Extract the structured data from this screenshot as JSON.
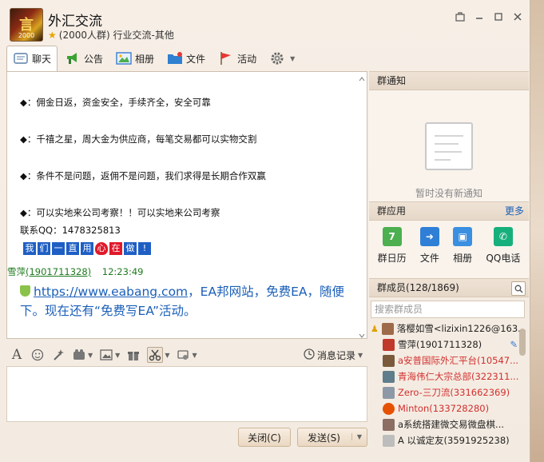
{
  "window": {
    "title": "外汇交流",
    "subtitle": "(2000人群) 行业交流-其他",
    "avatar_text": "言",
    "avatar_sub": "2000"
  },
  "tabs": [
    {
      "label": "聊天",
      "icon": "chat-icon"
    },
    {
      "label": "公告",
      "icon": "announcement-icon"
    },
    {
      "label": "相册",
      "icon": "album-icon"
    },
    {
      "label": "文件",
      "icon": "folder-icon"
    },
    {
      "label": "活动",
      "icon": "flag-icon"
    }
  ],
  "chat": {
    "lines": [
      "◆：佣金日返，资金安全，手续齐全，安全可靠",
      "◆：千禧之星，周大金为供应商，每笔交易都可以实物交割",
      "◆：条件不是问题，返佣不是问题，我们求得是长期合作双赢",
      "◆：可以实地来公司考察！！可以实地来公司考察"
    ],
    "qq_line": "联系QQ：1478325813",
    "banner": [
      "我",
      "们",
      "一",
      "直",
      "用",
      "心",
      "在",
      "做",
      "!"
    ],
    "sender_name": "雪萍",
    "sender_id": "(1901711328)",
    "sender_time": "12:23:49",
    "link_text": "https://www.eabang.com",
    "link_rest": "，EA邦网站，免费EA，随便下。现在还有“免费写EA”活动。"
  },
  "input_toolbar": {
    "history_label": "消息记录"
  },
  "buttons": {
    "close": "关闭(C)",
    "send": "发送(S)"
  },
  "notice": {
    "header": "群通知",
    "empty_text": "暂时没有新通知"
  },
  "apps": {
    "header": "群应用",
    "more": "更多",
    "items": [
      {
        "label": "群日历",
        "icon": "calendar-icon",
        "color": "#4caf50",
        "glyph": "7"
      },
      {
        "label": "文件",
        "icon": "file-transfer-icon",
        "color": "#2f7fd6",
        "glyph": "➜"
      },
      {
        "label": "相册",
        "icon": "album-icon",
        "color": "#3a8fe0",
        "glyph": "▣"
      },
      {
        "label": "QQ电话",
        "icon": "phone-icon",
        "color": "#17b07c",
        "glyph": "✆"
      }
    ]
  },
  "members": {
    "header": "群成员(128/1869)",
    "search_placeholder": "搜索群成员",
    "list": [
      {
        "name": "落樱如雪<lizixin1226@163...",
        "color": "#222",
        "avatar": "#9e6b4a"
      },
      {
        "name": "雪萍(1901711328)",
        "color": "#222",
        "avatar": "#c0392b"
      },
      {
        "name": "a安普国际外汇平台(10547...",
        "color": "#d32f2f",
        "avatar": "#7a5a3a"
      },
      {
        "name": "青海伟仁大宗总部(322311...",
        "color": "#d32f2f",
        "avatar": "#607d8b"
      },
      {
        "name": "Zero-三刀流(331662369)",
        "color": "#d32f2f",
        "avatar": "#8e99a8"
      },
      {
        "name": "Minton(133728280)",
        "color": "#d32f2f",
        "avatar": "#e65100"
      },
      {
        "name": "a系统搭建微交易微盘棋...",
        "color": "#222",
        "avatar": "#8d6e63"
      },
      {
        "name": "A  以诚定友(3591925238)",
        "color": "#222",
        "avatar": "#bdbdbd"
      }
    ]
  }
}
